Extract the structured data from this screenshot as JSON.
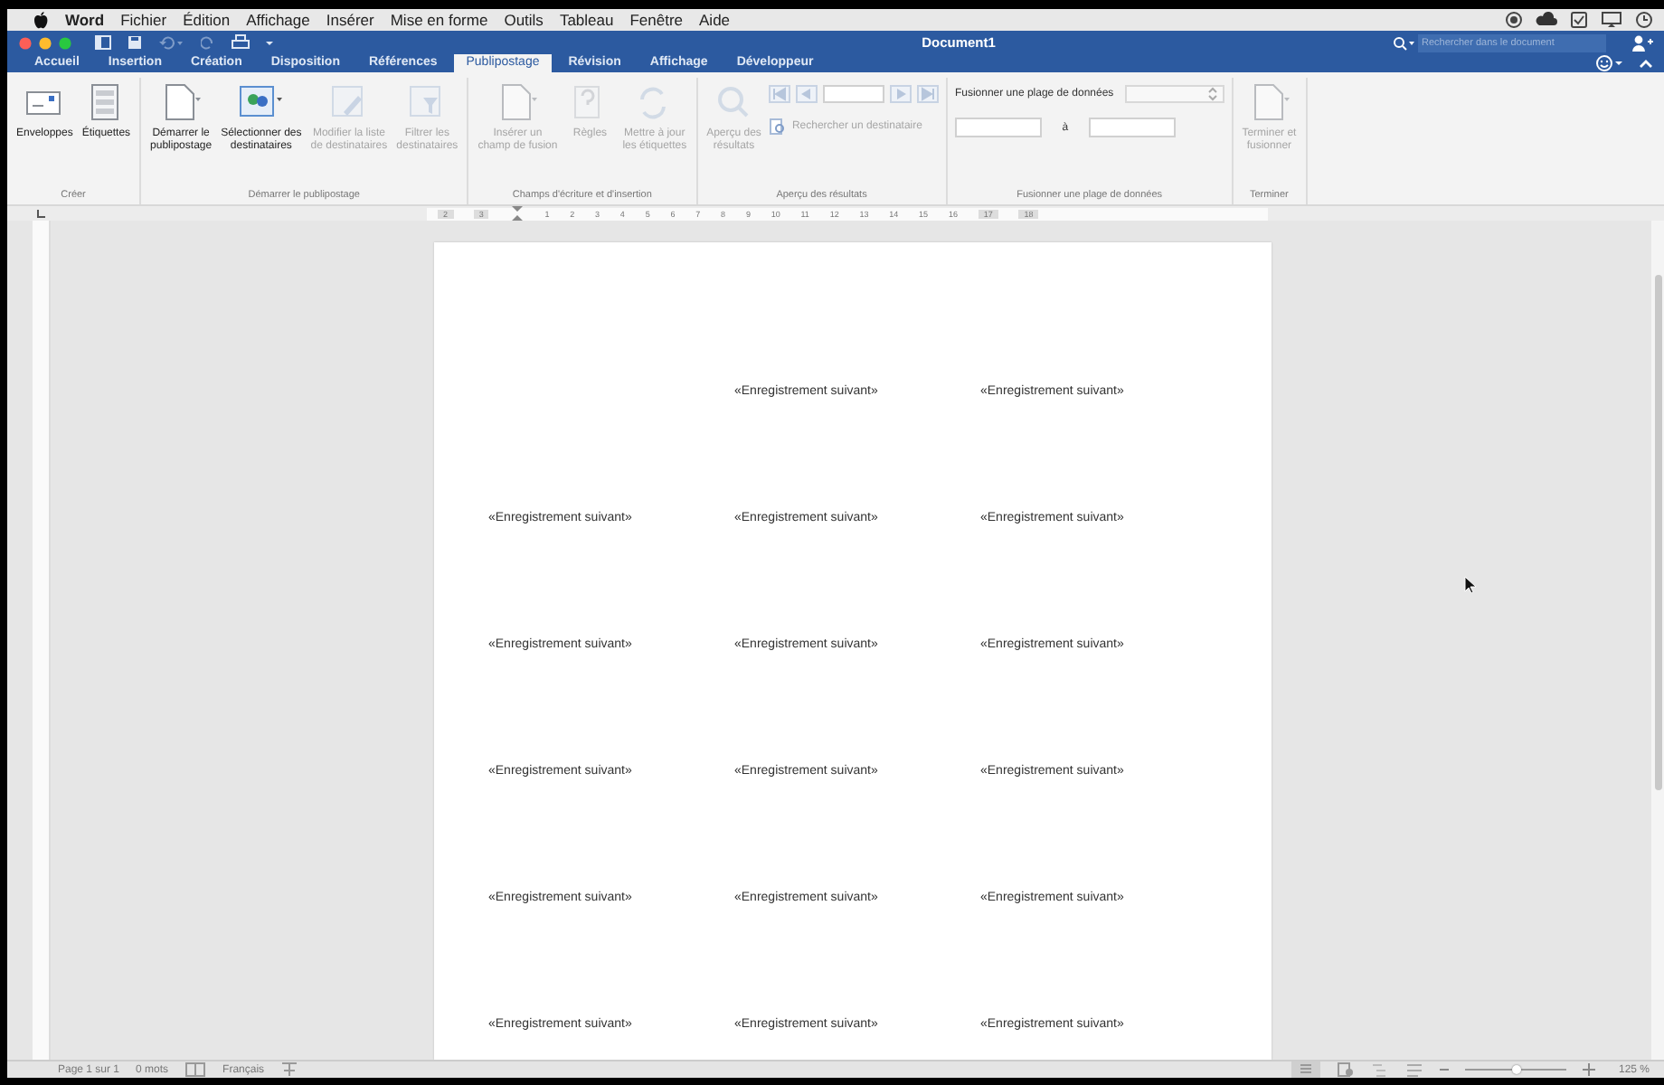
{
  "menu_bar": {
    "app": "Word",
    "items": [
      "Fichier",
      "Édition",
      "Affichage",
      "Insérer",
      "Mise en forme",
      "Outils",
      "Tableau",
      "Fenêtre",
      "Aide"
    ]
  },
  "window": {
    "title": "Document1",
    "search": {
      "placeholder": "Rechercher dans le document"
    }
  },
  "tabs": [
    {
      "label": "Accueil",
      "selected": false
    },
    {
      "label": "Insertion",
      "selected": false
    },
    {
      "label": "Création",
      "selected": false
    },
    {
      "label": "Disposition",
      "selected": false
    },
    {
      "label": "Références",
      "selected": false
    },
    {
      "label": "Publipostage",
      "selected": true
    },
    {
      "label": "Révision",
      "selected": false
    },
    {
      "label": "Affichage",
      "selected": false
    },
    {
      "label": "Développeur",
      "selected": false
    }
  ],
  "ribbon": [
    {
      "caption": "Créer",
      "buttons": [
        {
          "label": "Enveloppes",
          "kind": "envelope",
          "disabled": false
        },
        {
          "label": "Étiquettes",
          "kind": "labels",
          "disabled": false
        }
      ]
    },
    {
      "caption": "Démarrer le publipostage",
      "buttons": [
        {
          "label": "Démarrer le\npublipostage",
          "kind": "doc",
          "disabled": false
        },
        {
          "label": "Sélectionner des\ndestinataires",
          "kind": "people",
          "disabled": false
        },
        {
          "label": "Modifier la liste\nde destinataires",
          "kind": "edit",
          "disabled": true
        },
        {
          "label": "Filtrer les\ndestinataires",
          "kind": "filter",
          "disabled": true
        }
      ]
    },
    {
      "caption": "Champs d'écriture et d'insertion",
      "buttons": [
        {
          "label": "Insérer un\nchamp de fusion",
          "kind": "doc",
          "disabled": true
        },
        {
          "label": "Règles",
          "kind": "question",
          "disabled": true
        },
        {
          "label": "Mettre à jour\nles étiquettes",
          "kind": "refresh",
          "disabled": true
        }
      ]
    },
    {
      "caption": "Aperçu des résultats",
      "buttons": [
        {
          "label": "Aperçu des\nrésultats",
          "kind": "magnifier",
          "disabled": true
        }
      ],
      "find": "Rechercher un destinataire"
    },
    {
      "caption": "Fusionner une plage de données",
      "merge_label": "Fusionner une plage de données",
      "merge_to": "à"
    },
    {
      "caption": "Terminer",
      "buttons": [
        {
          "label": "Terminer et\nfusionner",
          "kind": "doc",
          "disabled": true
        }
      ]
    }
  ],
  "ruler": [
    "2",
    "3",
    "1",
    "2",
    "3",
    "4",
    "5",
    "6",
    "7",
    "8",
    "9",
    "10",
    "11",
    "12",
    "13",
    "14",
    "15",
    "16",
    "17",
    "18"
  ],
  "page": {
    "rows": [
      {
        "offset": true,
        "labels": [
          "«Enregistrement suivant»",
          "«Enregistrement suivant»"
        ]
      },
      {
        "offset": false,
        "labels": [
          "«Enregistrement suivant»",
          "«Enregistrement suivant»",
          "«Enregistrement suivant»"
        ]
      },
      {
        "offset": false,
        "labels": [
          "«Enregistrement suivant»",
          "«Enregistrement suivant»",
          "«Enregistrement suivant»"
        ]
      },
      {
        "offset": false,
        "labels": [
          "«Enregistrement suivant»",
          "«Enregistrement suivant»",
          "«Enregistrement suivant»"
        ]
      },
      {
        "offset": false,
        "labels": [
          "«Enregistrement suivant»",
          "«Enregistrement suivant»",
          "«Enregistrement suivant»"
        ]
      },
      {
        "offset": false,
        "labels": [
          "«Enregistrement suivant»",
          "«Enregistrement suivant»",
          "«Enregistrement suivant»"
        ]
      }
    ]
  },
  "status_bar": {
    "page": "Page 1 sur 1",
    "words": "0 mots",
    "language": "Français",
    "zoom": "125 %",
    "zoom_slider": {
      "level": 0.5
    }
  }
}
